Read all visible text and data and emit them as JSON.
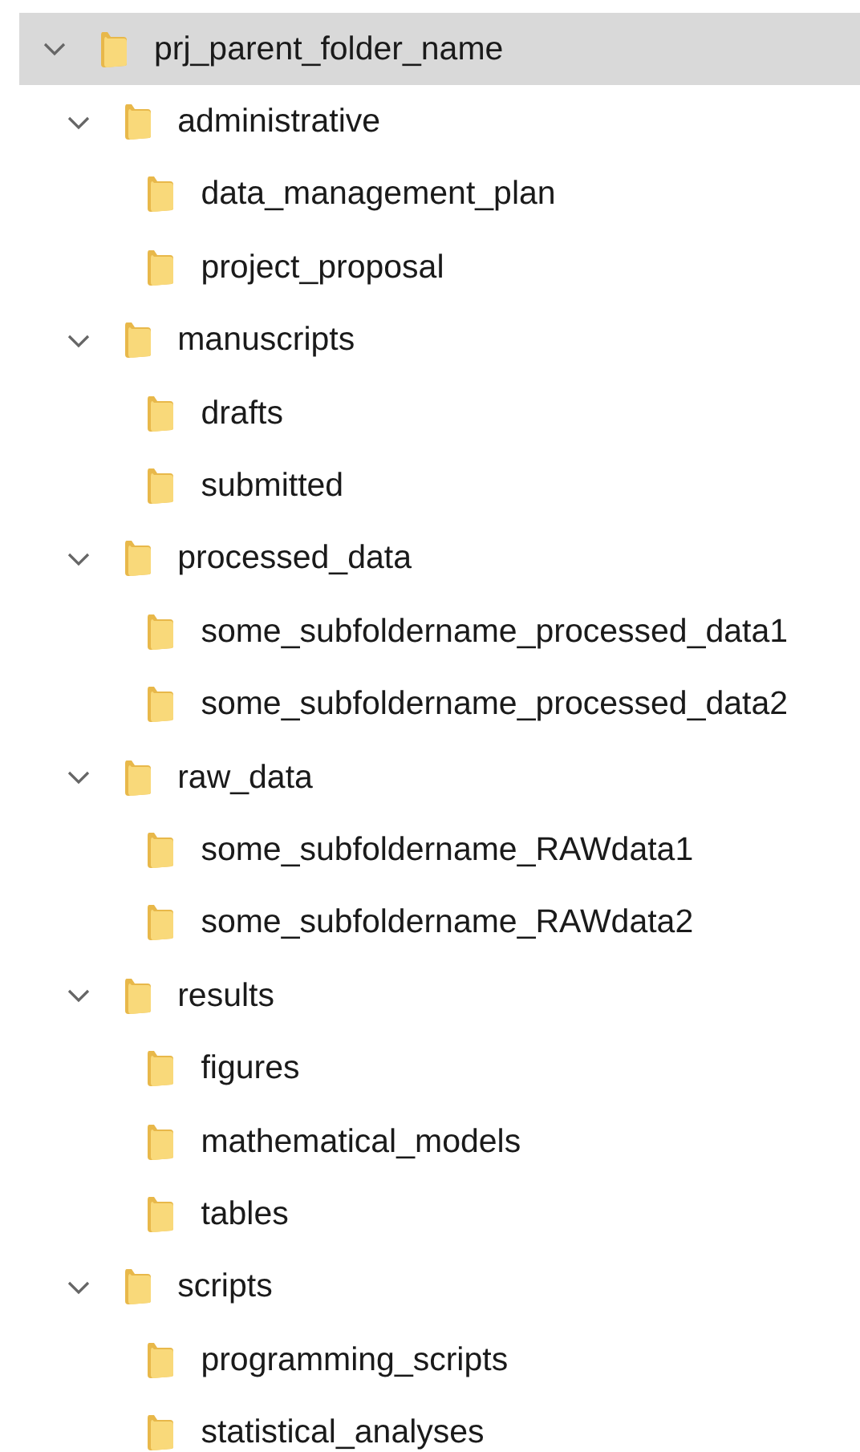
{
  "tree": [
    {
      "label": "prj_parent_folder_name",
      "selected": true,
      "expanded": true,
      "children": [
        {
          "label": "administrative",
          "selected": false,
          "expanded": true,
          "children": [
            {
              "label": "data_management_plan",
              "selected": false
            },
            {
              "label": "project_proposal",
              "selected": false
            }
          ]
        },
        {
          "label": "manuscripts",
          "selected": false,
          "expanded": true,
          "children": [
            {
              "label": "drafts",
              "selected": false
            },
            {
              "label": "submitted",
              "selected": false
            }
          ]
        },
        {
          "label": "processed_data",
          "selected": false,
          "expanded": true,
          "children": [
            {
              "label": "some_subfoldername_processed_data1",
              "selected": false
            },
            {
              "label": "some_subfoldername_processed_data2",
              "selected": false
            }
          ]
        },
        {
          "label": "raw_data",
          "selected": false,
          "expanded": true,
          "children": [
            {
              "label": "some_subfoldername_RAWdata1",
              "selected": false
            },
            {
              "label": "some_subfoldername_RAWdata2",
              "selected": false
            }
          ]
        },
        {
          "label": "results",
          "selected": false,
          "expanded": true,
          "children": [
            {
              "label": "figures",
              "selected": false
            },
            {
              "label": "mathematical_models",
              "selected": false
            },
            {
              "label": "tables",
              "selected": false
            }
          ]
        },
        {
          "label": "scripts",
          "selected": false,
          "expanded": true,
          "children": [
            {
              "label": "programming_scripts",
              "selected": false
            },
            {
              "label": "statistical_analyses",
              "selected": false
            }
          ]
        }
      ]
    }
  ]
}
